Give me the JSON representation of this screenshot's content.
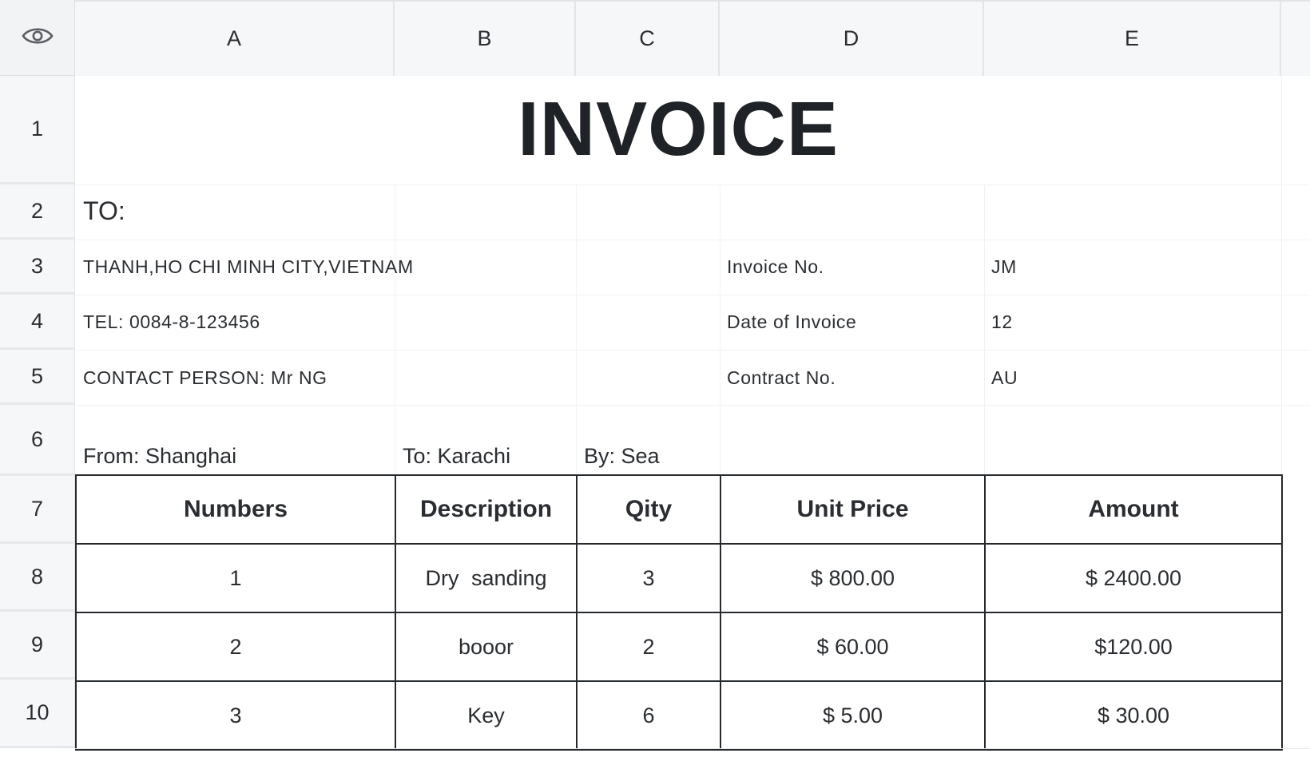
{
  "columns": [
    "A",
    "B",
    "C",
    "D",
    "E"
  ],
  "rows": [
    "1",
    "2",
    "3",
    "4",
    "5",
    "6",
    "7",
    "8",
    "9",
    "10"
  ],
  "invoice": {
    "title": "INVOICE",
    "to_label": "TO:",
    "address": "THANH,HO CHI MINH CITY,VIETNAM",
    "tel": "TEL: 0084-8-123456",
    "contact": "CONTACT PERSON: Mr NG",
    "invoice_no_label": "Invoice No.",
    "invoice_no_value": "JM",
    "date_label": "Date of Invoice",
    "date_value": "12",
    "contract_label": "Contract No.",
    "contract_value": "AU",
    "from": "From: Shanghai",
    "to": "To: Karachi",
    "by": "By: Sea"
  },
  "table": {
    "headers": [
      "Numbers",
      "Description",
      "Qity",
      "Unit Price",
      "Amount"
    ],
    "rows": [
      [
        "1",
        "Dry sanding",
        "3",
        "$ 800.00",
        "$ 2400.00"
      ],
      [
        "2",
        "booor",
        "2",
        "$ 60.00",
        "$120.00"
      ],
      [
        "3",
        "Key",
        "6",
        "$ 5.00",
        "$ 30.00"
      ]
    ]
  },
  "icons": {
    "view": "eye-icon"
  }
}
